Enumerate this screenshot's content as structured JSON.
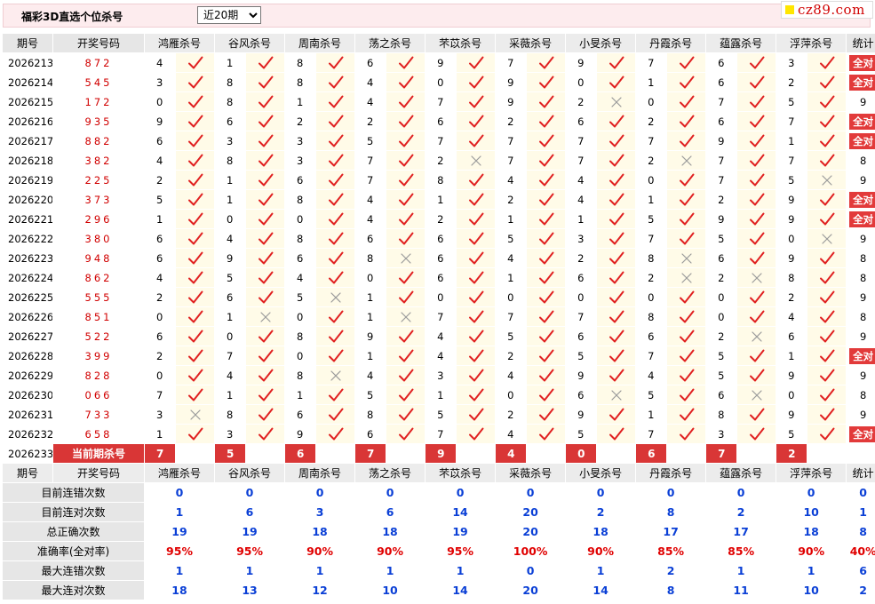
{
  "header": {
    "title": "福彩3D直选个位杀号",
    "period_selected": "近20期",
    "logo_text": "cz89.com"
  },
  "columns": {
    "issue": "期号",
    "number": "开奖号码",
    "experts": [
      "鸿雁杀号",
      "谷风杀号",
      "周南杀号",
      "荡之杀号",
      "芣苡杀号",
      "采薇杀号",
      "小旻杀号",
      "丹霞杀号",
      "蕴露杀号",
      "浮萍杀号"
    ],
    "total": "统计"
  },
  "rows": [
    {
      "issue": "2026213",
      "number": "872",
      "kills": [
        "4",
        "1",
        "8",
        "6",
        "9",
        "7",
        "9",
        "7",
        "6",
        "3"
      ],
      "ok": [
        1,
        1,
        1,
        1,
        1,
        1,
        1,
        1,
        1,
        1
      ],
      "total": "全对"
    },
    {
      "issue": "2026214",
      "number": "545",
      "kills": [
        "3",
        "8",
        "8",
        "4",
        "0",
        "9",
        "0",
        "1",
        "6",
        "2"
      ],
      "ok": [
        1,
        1,
        1,
        1,
        1,
        1,
        1,
        1,
        1,
        1
      ],
      "total": "全对"
    },
    {
      "issue": "2026215",
      "number": "172",
      "kills": [
        "0",
        "8",
        "1",
        "4",
        "7",
        "9",
        "2",
        "0",
        "7",
        "5"
      ],
      "ok": [
        1,
        1,
        1,
        1,
        1,
        1,
        0,
        1,
        1,
        1
      ],
      "total": "9"
    },
    {
      "issue": "2026216",
      "number": "935",
      "kills": [
        "9",
        "6",
        "2",
        "2",
        "6",
        "2",
        "6",
        "2",
        "6",
        "7"
      ],
      "ok": [
        1,
        1,
        1,
        1,
        1,
        1,
        1,
        1,
        1,
        1
      ],
      "total": "全对"
    },
    {
      "issue": "2026217",
      "number": "882",
      "kills": [
        "6",
        "3",
        "3",
        "5",
        "7",
        "7",
        "7",
        "7",
        "9",
        "1"
      ],
      "ok": [
        1,
        1,
        1,
        1,
        1,
        1,
        1,
        1,
        1,
        1
      ],
      "total": "全对"
    },
    {
      "issue": "2026218",
      "number": "382",
      "kills": [
        "4",
        "8",
        "3",
        "7",
        "2",
        "7",
        "7",
        "2",
        "7",
        "7"
      ],
      "ok": [
        1,
        1,
        1,
        1,
        0,
        1,
        1,
        0,
        1,
        1
      ],
      "total": "8"
    },
    {
      "issue": "2026219",
      "number": "225",
      "kills": [
        "2",
        "1",
        "6",
        "7",
        "8",
        "4",
        "4",
        "0",
        "7",
        "5"
      ],
      "ok": [
        1,
        1,
        1,
        1,
        1,
        1,
        1,
        1,
        1,
        0
      ],
      "total": "9"
    },
    {
      "issue": "2026220",
      "number": "373",
      "kills": [
        "5",
        "1",
        "8",
        "4",
        "1",
        "2",
        "4",
        "1",
        "2",
        "9"
      ],
      "ok": [
        1,
        1,
        1,
        1,
        1,
        1,
        1,
        1,
        1,
        1
      ],
      "total": "全对"
    },
    {
      "issue": "2026221",
      "number": "296",
      "kills": [
        "1",
        "0",
        "0",
        "4",
        "2",
        "1",
        "1",
        "5",
        "9",
        "9"
      ],
      "ok": [
        1,
        1,
        1,
        1,
        1,
        1,
        1,
        1,
        1,
        1
      ],
      "total": "全对"
    },
    {
      "issue": "2026222",
      "number": "380",
      "kills": [
        "6",
        "4",
        "8",
        "6",
        "6",
        "5",
        "3",
        "7",
        "5",
        "0"
      ],
      "ok": [
        1,
        1,
        1,
        1,
        1,
        1,
        1,
        1,
        1,
        0
      ],
      "total": "9"
    },
    {
      "issue": "2026223",
      "number": "948",
      "kills": [
        "6",
        "9",
        "6",
        "8",
        "6",
        "4",
        "2",
        "8",
        "6",
        "9"
      ],
      "ok": [
        1,
        1,
        1,
        0,
        1,
        1,
        1,
        0,
        1,
        1
      ],
      "total": "8"
    },
    {
      "issue": "2026224",
      "number": "862",
      "kills": [
        "4",
        "5",
        "4",
        "0",
        "6",
        "1",
        "6",
        "2",
        "2",
        "8"
      ],
      "ok": [
        1,
        1,
        1,
        1,
        1,
        1,
        1,
        0,
        0,
        1
      ],
      "total": "8"
    },
    {
      "issue": "2026225",
      "number": "555",
      "kills": [
        "2",
        "6",
        "5",
        "1",
        "0",
        "0",
        "0",
        "0",
        "0",
        "2"
      ],
      "ok": [
        1,
        1,
        0,
        1,
        1,
        1,
        1,
        1,
        1,
        1
      ],
      "total": "9"
    },
    {
      "issue": "2026226",
      "number": "851",
      "kills": [
        "0",
        "1",
        "0",
        "1",
        "7",
        "7",
        "7",
        "8",
        "0",
        "4"
      ],
      "ok": [
        1,
        0,
        1,
        0,
        1,
        1,
        1,
        1,
        1,
        1
      ],
      "total": "8"
    },
    {
      "issue": "2026227",
      "number": "522",
      "kills": [
        "6",
        "0",
        "8",
        "9",
        "4",
        "5",
        "6",
        "6",
        "2",
        "6"
      ],
      "ok": [
        1,
        1,
        1,
        1,
        1,
        1,
        1,
        1,
        0,
        1
      ],
      "total": "9"
    },
    {
      "issue": "2026228",
      "number": "399",
      "kills": [
        "2",
        "7",
        "0",
        "1",
        "4",
        "2",
        "5",
        "7",
        "5",
        "1"
      ],
      "ok": [
        1,
        1,
        1,
        1,
        1,
        1,
        1,
        1,
        1,
        1
      ],
      "total": "全对"
    },
    {
      "issue": "2026229",
      "number": "828",
      "kills": [
        "0",
        "4",
        "8",
        "4",
        "3",
        "4",
        "9",
        "4",
        "5",
        "9"
      ],
      "ok": [
        1,
        1,
        0,
        1,
        1,
        1,
        1,
        1,
        1,
        1
      ],
      "total": "9"
    },
    {
      "issue": "2026230",
      "number": "066",
      "kills": [
        "7",
        "1",
        "1",
        "5",
        "1",
        "0",
        "6",
        "5",
        "6",
        "0"
      ],
      "ok": [
        1,
        1,
        1,
        1,
        1,
        1,
        0,
        1,
        0,
        1
      ],
      "total": "8"
    },
    {
      "issue": "2026231",
      "number": "733",
      "kills": [
        "3",
        "8",
        "6",
        "8",
        "5",
        "2",
        "9",
        "1",
        "8",
        "9"
      ],
      "ok": [
        0,
        1,
        1,
        1,
        1,
        1,
        1,
        1,
        1,
        1
      ],
      "total": "9"
    },
    {
      "issue": "2026232",
      "number": "658",
      "kills": [
        "1",
        "3",
        "9",
        "6",
        "7",
        "4",
        "5",
        "7",
        "3",
        "5"
      ],
      "ok": [
        1,
        1,
        1,
        1,
        1,
        1,
        1,
        1,
        1,
        1
      ],
      "total": "全对"
    }
  ],
  "current": {
    "issue": "2026233",
    "label": "当前期杀号",
    "kills": [
      "7",
      "5",
      "6",
      "7",
      "9",
      "4",
      "0",
      "6",
      "7",
      "2"
    ]
  },
  "stats": [
    {
      "label": "目前连错次数",
      "values": [
        "0",
        "0",
        "0",
        "0",
        "0",
        "0",
        "0",
        "0",
        "0",
        "0"
      ],
      "total": "0",
      "red": false
    },
    {
      "label": "目前连对次数",
      "values": [
        "1",
        "6",
        "3",
        "6",
        "14",
        "20",
        "2",
        "8",
        "2",
        "10"
      ],
      "total": "1",
      "red": false
    },
    {
      "label": "总正确次数",
      "values": [
        "19",
        "19",
        "18",
        "18",
        "19",
        "20",
        "18",
        "17",
        "17",
        "18"
      ],
      "total": "8",
      "red": false
    },
    {
      "label": "准确率(全对率)",
      "values": [
        "95%",
        "95%",
        "90%",
        "90%",
        "95%",
        "100%",
        "90%",
        "85%",
        "85%",
        "90%"
      ],
      "total": "40%",
      "red": true
    },
    {
      "label": "最大连错次数",
      "values": [
        "1",
        "1",
        "1",
        "1",
        "1",
        "0",
        "1",
        "2",
        "1",
        "1"
      ],
      "total": "6",
      "red": false
    },
    {
      "label": "最大连对次数",
      "values": [
        "18",
        "13",
        "12",
        "10",
        "14",
        "20",
        "14",
        "8",
        "11",
        "10"
      ],
      "total": "2",
      "red": false
    }
  ],
  "colors": {
    "accent": "#d93636",
    "check": "#e02020",
    "cross": "#9a9a9a",
    "stat_blue": "#0a3fd6"
  }
}
